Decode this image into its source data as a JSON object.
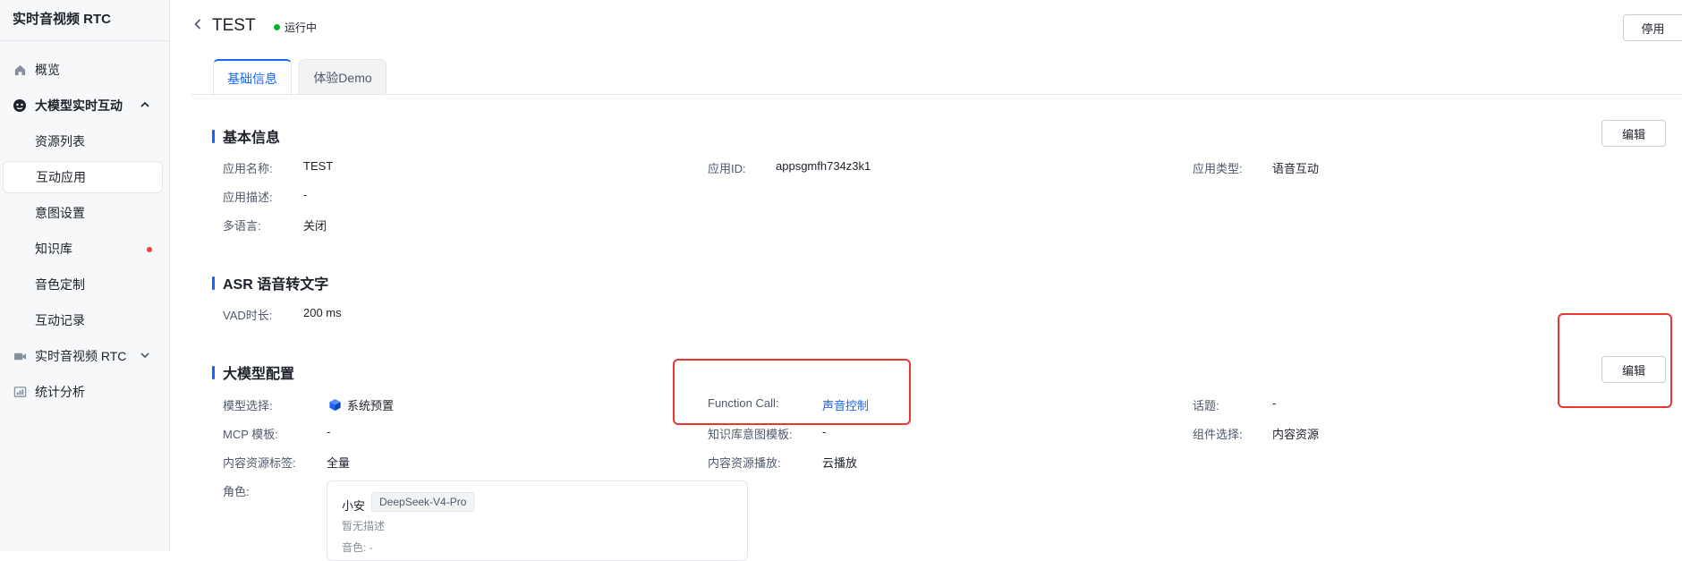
{
  "sidebar": {
    "title": "实时音视频 RTC",
    "items": [
      {
        "label": "概览",
        "icon": "home-icon"
      },
      {
        "label": "大模型实时互动",
        "icon": "ai-chat-icon"
      },
      {
        "label": "资源列表"
      },
      {
        "label": "互动应用"
      },
      {
        "label": "意图设置"
      },
      {
        "label": "知识库"
      },
      {
        "label": "音色定制"
      },
      {
        "label": "互动记录"
      },
      {
        "label": "实时音视频 RTC",
        "icon": "video-icon"
      },
      {
        "label": "统计分析",
        "icon": "chart-icon"
      }
    ],
    "active_index": 3,
    "accent": "#1664ff"
  },
  "header": {
    "title": "TEST",
    "status": "运行中",
    "status_color": "#00b42a",
    "disable_label": "停用"
  },
  "tabs": [
    {
      "label": "基础信息",
      "active": true
    },
    {
      "label": "体验Demo",
      "active": false
    }
  ],
  "basic": {
    "title": "基本信息",
    "edit_label": "编辑",
    "app_name_label": "应用名称:",
    "app_name": "TEST",
    "app_id_label": "应用ID:",
    "app_id": "appsgmfh734z3k1",
    "app_type_label": "应用类型:",
    "app_type": "语音互动",
    "app_desc_label": "应用描述:",
    "app_desc": "-",
    "multi_lang_label": "多语言:",
    "multi_lang": "关闭"
  },
  "asr": {
    "title": "ASR 语音转文字",
    "vad_label": "VAD时长:",
    "vad": "200 ms"
  },
  "llm": {
    "title": "大模型配置",
    "edit_label": "编辑",
    "model_label": "模型选择:",
    "model": "系统预置",
    "function_call_label": "Function Call:",
    "function_call": "声音控制",
    "topic_label": "话题:",
    "topic": "-",
    "mcp_label": "MCP 模板:",
    "mcp": "-",
    "kb_intent_label": "知识库意图模板:",
    "kb_intent": "-",
    "component_label": "组件选择:",
    "component": "内容资源",
    "content_tag_label": "内容资源标签:",
    "content_tag": "全量",
    "content_play_label": "内容资源播放:",
    "content_play": "云播放",
    "role_label": "角色:",
    "role": {
      "name": "小安",
      "model_tag": "DeepSeek-V4-Pro",
      "desc": "暂无描述",
      "voice": "音色: -"
    }
  },
  "highlight_color": "#e8382f"
}
